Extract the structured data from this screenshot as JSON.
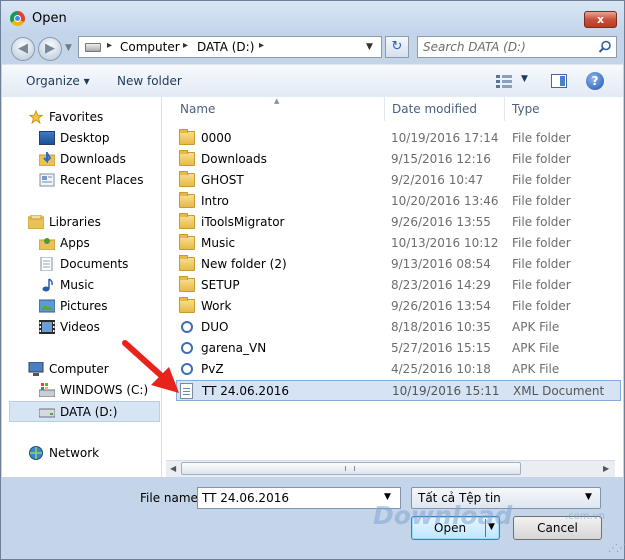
{
  "window": {
    "title": "Open",
    "close_glyph": "x"
  },
  "nav": {
    "back_glyph": "◀",
    "forward_glyph": "▶",
    "dropdown_glyph": "▼",
    "refresh_glyph": "↻"
  },
  "address": {
    "separator": "▸",
    "crumbs": [
      "Computer",
      "DATA (D:)"
    ],
    "dropdown_glyph": "▼"
  },
  "search": {
    "placeholder": "Search DATA (D:)"
  },
  "toolbar": {
    "organize_label": "Organize ▾",
    "new_folder_label": "New folder",
    "views_drop_glyph": "▼",
    "help_glyph": "?"
  },
  "navpane": {
    "favorites": "Favorites",
    "desktop": "Desktop",
    "downloads": "Downloads",
    "recent": "Recent Places",
    "libraries": "Libraries",
    "apps": "Apps",
    "documents": "Documents",
    "music": "Music",
    "pictures": "Pictures",
    "videos": "Videos",
    "computer": "Computer",
    "windows_c": "WINDOWS (C:)",
    "data_d": "DATA (D:)",
    "network": "Network"
  },
  "columns": {
    "name": "Name",
    "date": "Date modified",
    "type": "Type",
    "sort_glyph": "▲"
  },
  "files": [
    {
      "name": "0000",
      "date": "10/19/2016 17:14",
      "type": "File folder",
      "icon": "folder-icon"
    },
    {
      "name": "Downloads",
      "date": "9/15/2016 12:16",
      "type": "File folder",
      "icon": "folder-icon"
    },
    {
      "name": "GHOST",
      "date": "9/2/2016 10:47",
      "type": "File folder",
      "icon": "folder-icon"
    },
    {
      "name": "Intro",
      "date": "10/20/2016 13:46",
      "type": "File folder",
      "icon": "folder-icon"
    },
    {
      "name": "iToolsMigrator",
      "date": "9/26/2016 13:55",
      "type": "File folder",
      "icon": "folder-icon"
    },
    {
      "name": "Music",
      "date": "10/13/2016 10:12",
      "type": "File folder",
      "icon": "folder-icon"
    },
    {
      "name": "New folder (2)",
      "date": "9/13/2016 08:54",
      "type": "File folder",
      "icon": "folder-icon"
    },
    {
      "name": "SETUP",
      "date": "8/23/2016 14:29",
      "type": "File folder",
      "icon": "folder-icon"
    },
    {
      "name": "Work",
      "date": "9/26/2016 13:54",
      "type": "File folder",
      "icon": "folder-icon"
    },
    {
      "name": "DUO",
      "date": "8/18/2016 10:35",
      "type": "APK File",
      "icon": "apk-icon"
    },
    {
      "name": "garena_VN",
      "date": "5/27/2016 15:15",
      "type": "APK File",
      "icon": "apk-icon"
    },
    {
      "name": "PvZ",
      "date": "4/25/2016 10:18",
      "type": "APK File",
      "icon": "apk-icon"
    },
    {
      "name": "TT 24.06.2016",
      "date": "10/19/2016 15:11",
      "type": "XML Document",
      "icon": "xml-icon",
      "selected": true
    }
  ],
  "scroll": {
    "left_glyph": "◀",
    "right_glyph": "▶"
  },
  "footer": {
    "filename_label": "File name:",
    "filename_value": "TT 24.06.2016",
    "dropdown_glyph": "▼",
    "filetype_value": "Tất cả Tệp tin",
    "open_label": "Open",
    "cancel_label": "Cancel"
  },
  "watermark": {
    "text": "Download",
    "suffix": ".com.vn"
  },
  "colors": {
    "window_frame": "#c4d5e9",
    "selection": "#d5e3f4",
    "arrow": "#e8231c"
  }
}
